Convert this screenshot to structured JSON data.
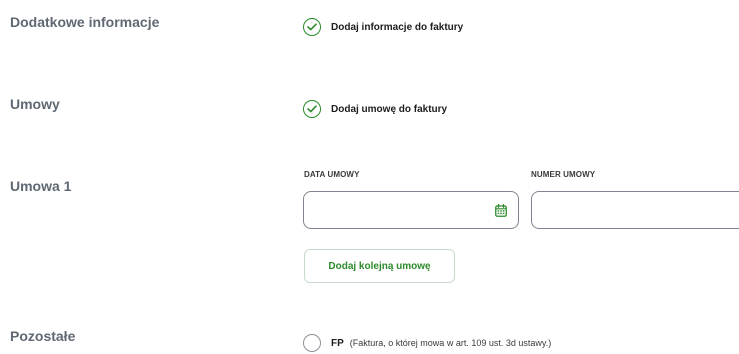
{
  "sections": {
    "additional_info": {
      "label": "Dodatkowe informacje",
      "checkbox_label": "Dodaj informacje do faktury",
      "checked": true
    },
    "contracts": {
      "label": "Umowy",
      "checkbox_label": "Dodaj umowę do faktury",
      "checked": true
    },
    "contract_1": {
      "label": "Umowa 1",
      "date_field_label": "DATA UMOWY",
      "date_field_value": "",
      "number_field_label": "NUMER UMOWY",
      "number_field_value": "",
      "add_button_label": "Dodaj kolejną umowę"
    },
    "other": {
      "label": "Pozostałe",
      "fp_abbr": "FP",
      "fp_description": "(Faktura, o której mowa w art. 109 ust. 3d ustawy.)",
      "checked": false
    }
  },
  "colors": {
    "accent_green": "#2c8a2c",
    "section_label": "#5f6873",
    "input_border": "#7f868f"
  },
  "icons": {
    "check": "check-icon",
    "calendar": "calendar-icon"
  }
}
